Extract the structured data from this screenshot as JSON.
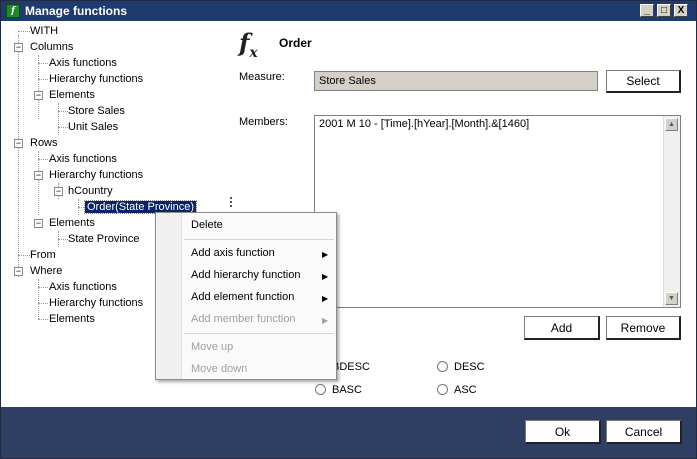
{
  "window": {
    "title": "Manage functions"
  },
  "title_buttons": {
    "minimize": "_",
    "maximize": "□",
    "close": "X"
  },
  "tree": [
    {
      "label": "WITH",
      "selected": false
    },
    {
      "label": "Columns",
      "expander": "−"
    },
    {
      "label": "Axis functions"
    },
    {
      "label": "Hierarchy functions"
    },
    {
      "label": "Elements",
      "expander": "−"
    },
    {
      "label": "Store Sales"
    },
    {
      "label": "Unit Sales"
    },
    {
      "label": "Rows",
      "expander": "−"
    },
    {
      "label": "Axis functions"
    },
    {
      "label": "Hierarchy functions",
      "expander": "−"
    },
    {
      "label": "hCountry",
      "expander": "−"
    },
    {
      "label": "Order(State Province)",
      "selected": true
    },
    {
      "label": "Elements",
      "expander": "−"
    },
    {
      "label": "State Province"
    },
    {
      "label": "From"
    },
    {
      "label": "Where",
      "expander": "−"
    },
    {
      "label": "Axis functions"
    },
    {
      "label": "Hierarchy functions"
    },
    {
      "label": "Elements"
    }
  ],
  "editor": {
    "function_name": "Order",
    "fx_glyph": "f",
    "fx_sub": "x",
    "measure_label": "Measure:",
    "measure_value": "Store Sales",
    "select_button": "Select",
    "members_label": "Members:",
    "members_value": "2001 M 10 - [Time].[hYear].[Month].&[1460]",
    "add_button": "Add",
    "remove_button": "Remove",
    "scroll_up": "▲",
    "scroll_down": "▼"
  },
  "sort_options": [
    {
      "label": "BDESC",
      "shown": "DESC"
    },
    {
      "label": "DESC"
    },
    {
      "label": "BASC"
    },
    {
      "label": "ASC"
    }
  ],
  "context_menu": {
    "items": [
      {
        "label": "Delete",
        "enabled": true,
        "submenu": false
      },
      {
        "label": "Add axis function",
        "enabled": true,
        "submenu": true
      },
      {
        "label": "Add hierarchy function",
        "enabled": true,
        "submenu": true
      },
      {
        "label": "Add element function",
        "enabled": true,
        "submenu": true
      },
      {
        "label": "Add member function",
        "enabled": false,
        "submenu": true
      },
      {
        "label": "Move up",
        "enabled": false,
        "submenu": false
      },
      {
        "label": "Move down",
        "enabled": false,
        "submenu": false
      }
    ],
    "arrow": "▶"
  },
  "footer": {
    "ok_button": "Ok",
    "cancel_button": "Cancel"
  },
  "colors": {
    "titlebar": "#1d3b6e",
    "footer": "#2e3f63",
    "selection": "#0a246a"
  }
}
